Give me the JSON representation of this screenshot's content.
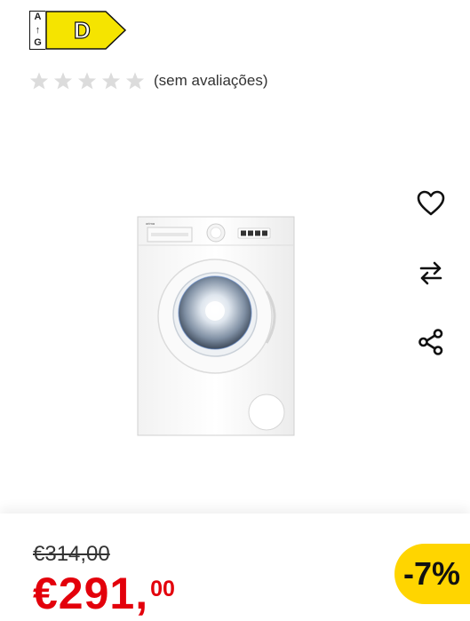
{
  "energy_label": {
    "scale_top": "A",
    "scale_arrow": "↑",
    "scale_bottom": "G",
    "class": "D"
  },
  "rating": {
    "stars": 0,
    "max_stars": 5,
    "text": "(sem avaliações)"
  },
  "product": {
    "brand": "orima"
  },
  "actions": {
    "favorite_icon": "heart-icon",
    "compare_icon": "swap-icon",
    "share_icon": "share-icon"
  },
  "price": {
    "old": "€314,00",
    "current_main": "€291,",
    "current_cents": "00",
    "discount": "-7%"
  },
  "colors": {
    "price_red": "#e3000b",
    "discount_yellow": "#ffd500",
    "energy_yellow": "#f5e400",
    "star_gray": "#dcdcdc"
  }
}
